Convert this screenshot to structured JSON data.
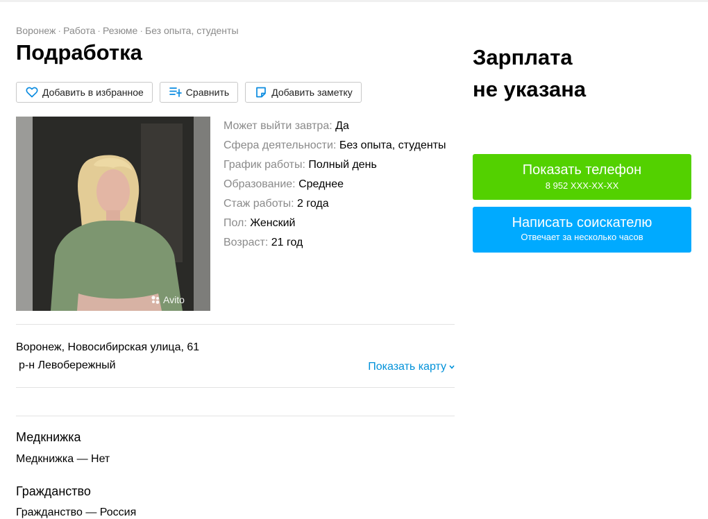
{
  "breadcrumb": {
    "items": [
      "Воронеж",
      "Работа",
      "Резюме",
      "Без опыта, студенты"
    ],
    "separator": "·"
  },
  "title": "Подработка",
  "actions": {
    "favorite": "Добавить в избранное",
    "compare": "Сравнить",
    "note": "Добавить заметку"
  },
  "photo": {
    "watermark": "Avito"
  },
  "params": [
    {
      "key": "Может выйти завтра:",
      "value": "Да"
    },
    {
      "key": "Сфера деятельности:",
      "value": "Без опыта, студенты"
    },
    {
      "key": "График работы:",
      "value": "Полный день"
    },
    {
      "key": "Образование:",
      "value": "Среднее"
    },
    {
      "key": "Стаж работы:",
      "value": "2 года"
    },
    {
      "key": "Пол:",
      "value": "Женский"
    },
    {
      "key": "Возраст:",
      "value": "21 год"
    }
  ],
  "location": {
    "address": "Воронеж, Новосибирская улица, 61",
    "district": "р-н Левобережный",
    "show_map": "Показать карту"
  },
  "sections": {
    "medbook": {
      "heading": "Медкнижка",
      "text": "Медкнижка — Нет"
    },
    "citizenship": {
      "heading": "Гражданство",
      "text": "Гражданство — Россия"
    }
  },
  "salary": {
    "line1": "Зарплата",
    "line2": "не указана"
  },
  "phone_button": {
    "label": "Показать телефон",
    "number": "8 952 XXX-XX-XX"
  },
  "message_button": {
    "label": "Написать соискателю",
    "sub": "Отвечает за несколько часов"
  },
  "colors": {
    "green": "#53d100",
    "blue": "#00aaff",
    "link": "#0091d9",
    "muted": "#8a8a8a"
  },
  "icons": {
    "favorite": "heart-icon",
    "compare": "compare-icon",
    "note": "note-icon",
    "map": "chevron-down-icon"
  }
}
